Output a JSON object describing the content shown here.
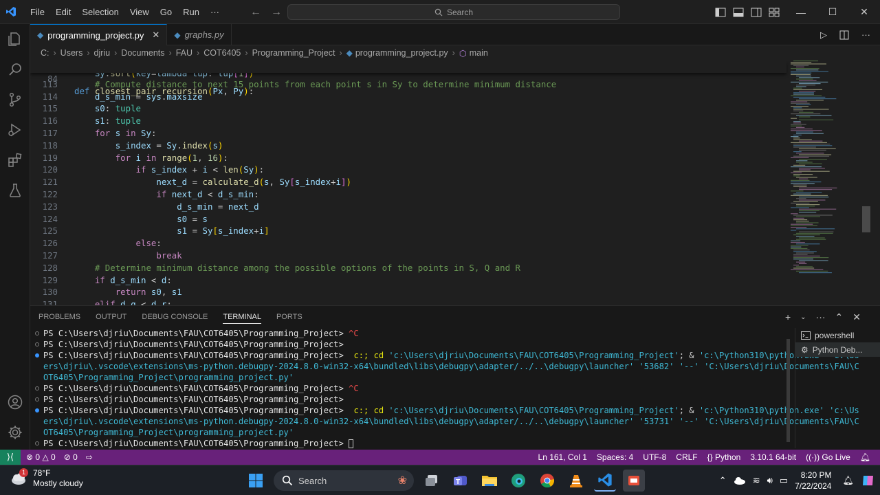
{
  "titlebar": {
    "menu": [
      "File",
      "Edit",
      "Selection",
      "View",
      "Go",
      "Run",
      "···"
    ],
    "search_placeholder": "Search"
  },
  "tabs": [
    {
      "label": "programming_project.py",
      "active": true
    },
    {
      "label": "graphs.py",
      "active": false
    }
  ],
  "breadcrumb": [
    "C:",
    "Users",
    "djriu",
    "Documents",
    "FAU",
    "COT6405",
    "Programming_Project",
    "programming_project.py",
    "main"
  ],
  "editor": {
    "sticky_line": {
      "num": "84",
      "text": "def closest_pair_recursion(Px, Py):"
    },
    "partial_line": "    Sy.sort(key=lambda tup: tup[1])",
    "lines": [
      {
        "num": "113",
        "text": "    # Compute distance to next 15 points from each point s in Sy to determine minimum distance"
      },
      {
        "num": "114",
        "text": "    d_s_min = sys.maxsize"
      },
      {
        "num": "115",
        "text": "    s0: tuple"
      },
      {
        "num": "116",
        "text": "    s1: tuple"
      },
      {
        "num": "117",
        "text": "    for s in Sy:"
      },
      {
        "num": "118",
        "text": "        s_index = Sy.index(s)"
      },
      {
        "num": "119",
        "text": "        for i in range(1, 16):"
      },
      {
        "num": "120",
        "text": "            if s_index + i < len(Sy):"
      },
      {
        "num": "121",
        "text": "                next_d = calculate_d(s, Sy[s_index+i])"
      },
      {
        "num": "122",
        "text": "                if next_d < d_s_min:"
      },
      {
        "num": "123",
        "text": "                    d_s_min = next_d"
      },
      {
        "num": "124",
        "text": "                    s0 = s"
      },
      {
        "num": "125",
        "text": "                    s1 = Sy[s_index+i]"
      },
      {
        "num": "126",
        "text": "            else:"
      },
      {
        "num": "127",
        "text": "                break"
      },
      {
        "num": "128",
        "text": "    # Determine minimum distance among the possible options of the points in S, Q and R"
      },
      {
        "num": "129",
        "text": "    if d_s_min < d:"
      },
      {
        "num": "130",
        "text": "        return s0, s1"
      },
      {
        "num": "131",
        "text": "    elif d_q < d_r:"
      }
    ]
  },
  "panel": {
    "tabs": [
      "PROBLEMS",
      "OUTPUT",
      "DEBUG CONSOLE",
      "TERMINAL",
      "PORTS"
    ],
    "active_tab": "TERMINAL",
    "terminals": [
      "powershell",
      "Python Deb..."
    ],
    "terminal_lines": [
      {
        "prompt": "PS C:\\Users\\djriu\\Documents\\FAU\\COT6405\\Programming_Project> ",
        "cmd": "^C"
      },
      {
        "prompt": "PS C:\\Users\\djriu\\Documents\\FAU\\COT6405\\Programming_Project>",
        "cmd": ""
      },
      {
        "prompt": "PS C:\\Users\\djriu\\Documents\\FAU\\COT6405\\Programming_Project> ",
        "cmd": " c:; cd 'c:\\Users\\djriu\\Documents\\FAU\\COT6405\\Programming_Project'; & 'c:\\Python310\\python.exe' 'c:\\Us"
      },
      {
        "prompt": "",
        "cmd": "ers\\djriu\\.vscode\\extensions\\ms-python.debugpy-2024.8.0-win32-x64\\bundled\\libs\\debugpy\\adapter/../..\\debugpy\\launcher' '53682' '--' 'C:\\Users\\djriu\\Documents\\FAU\\C"
      },
      {
        "prompt": "",
        "cmd": "OT6405\\Programming_Project\\programming_project.py'"
      },
      {
        "prompt": "PS C:\\Users\\djriu\\Documents\\FAU\\COT6405\\Programming_Project> ",
        "cmd": "^C"
      },
      {
        "prompt": "PS C:\\Users\\djriu\\Documents\\FAU\\COT6405\\Programming_Project>",
        "cmd": ""
      },
      {
        "prompt": "PS C:\\Users\\djriu\\Documents\\FAU\\COT6405\\Programming_Project> ",
        "cmd": " c:; cd 'c:\\Users\\djriu\\Documents\\FAU\\COT6405\\Programming_Project'; & 'c:\\Python310\\python.exe' 'c:\\Us"
      },
      {
        "prompt": "",
        "cmd": "ers\\djriu\\.vscode\\extensions\\ms-python.debugpy-2024.8.0-win32-x64\\bundled\\libs\\debugpy\\adapter/../..\\debugpy\\launcher' '53731' '--' 'C:\\Users\\djriu\\Documents\\FAU\\C"
      },
      {
        "prompt": "",
        "cmd": "OT6405\\Programming_Project\\programming_project.py'"
      },
      {
        "prompt": "PS C:\\Users\\djriu\\Documents\\FAU\\COT6405\\Programming_Project> ",
        "cmd": ""
      }
    ]
  },
  "statusbar": {
    "errors": "0",
    "warnings": "0",
    "ports": "0",
    "position": "Ln 161, Col 1",
    "spaces": "Spaces: 4",
    "encoding": "UTF-8",
    "eol": "CRLF",
    "language": "Python",
    "interpreter": "3.10.1 64-bit",
    "golive": "Go Live"
  },
  "taskbar": {
    "weather_temp": "78°F",
    "weather_desc": "Mostly cloudy",
    "weather_badge": "1",
    "search_placeholder": "Search",
    "time": "8:20 PM",
    "date": "7/22/2024"
  },
  "colors": {
    "statusbar": "#68217a",
    "remote": "#16825d",
    "accent": "#0078d4"
  }
}
